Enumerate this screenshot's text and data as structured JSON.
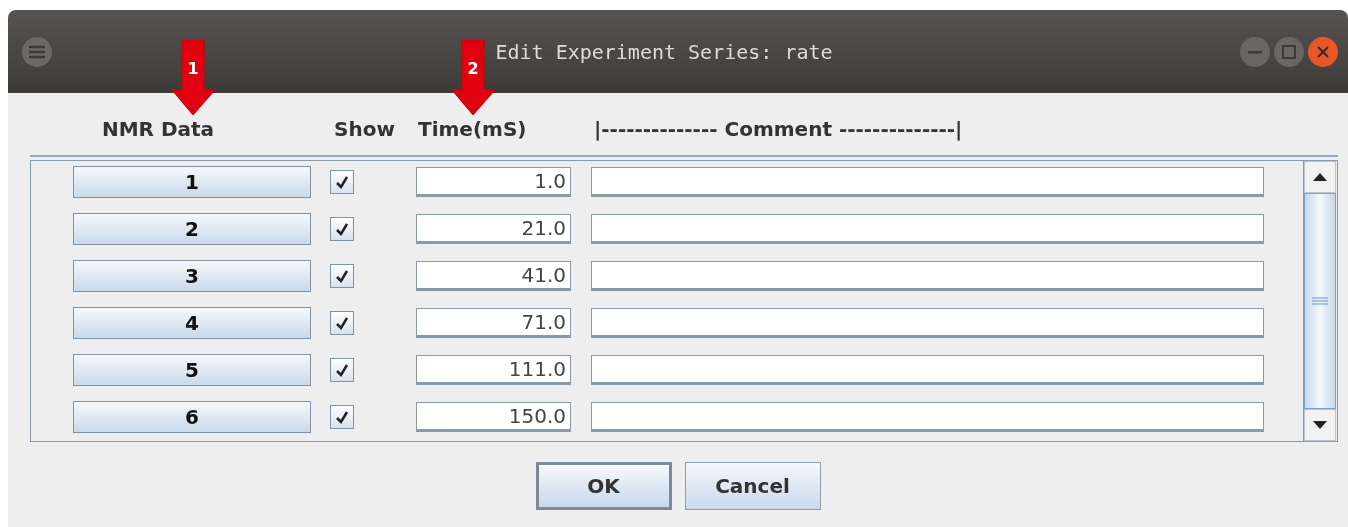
{
  "window": {
    "title": "Edit Experiment Series: rate"
  },
  "annotations": [
    {
      "label": "1"
    },
    {
      "label": "2"
    }
  ],
  "columns": [
    {
      "label": "NMR Data"
    },
    {
      "label": "Show"
    },
    {
      "label": "Time(mS)"
    },
    {
      "label": "|-------------- Comment --------------|"
    }
  ],
  "rows": [
    {
      "data": "1",
      "show": true,
      "time": "1.0"
    },
    {
      "data": "2",
      "show": true,
      "time": "21.0"
    },
    {
      "data": "3",
      "show": true,
      "time": "41.0"
    },
    {
      "data": "4",
      "show": true,
      "time": "71.0"
    },
    {
      "data": "5",
      "show": true,
      "time": "111.0"
    },
    {
      "data": "6",
      "show": true,
      "time": "150.0"
    }
  ],
  "buttons": [
    {
      "label": "OK",
      "focused": true
    },
    {
      "label": "Cancel",
      "focused": false
    }
  ]
}
